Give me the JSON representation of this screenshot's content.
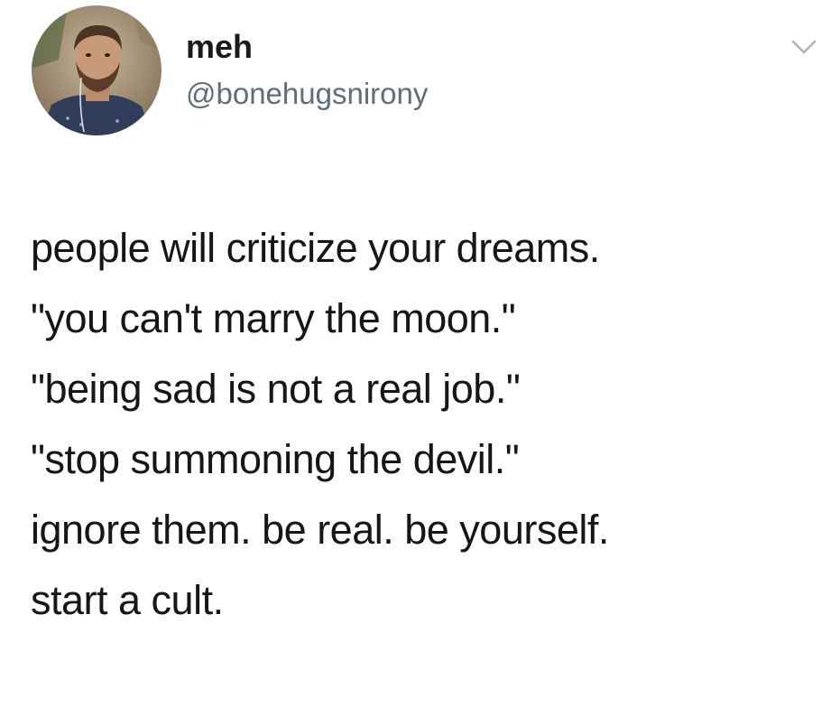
{
  "tweet": {
    "display_name": "meh",
    "handle": "@bonehugsnirony",
    "lines": [
      "people will criticize your dreams.",
      "\"you can't marry the moon.\"",
      "\"being sad is not a real job.\"",
      "\"stop summoning the devil.\"",
      "ignore them. be real. be yourself.",
      "start a cult."
    ]
  },
  "icons": {
    "avatar": "profile-photo",
    "menu": "chevron-down-icon"
  },
  "colors": {
    "background": "#ffffff",
    "name_text": "#1a1a1a",
    "handle_text": "#5e6e7a",
    "body_text": "#161616",
    "chevron": "#aab4bd"
  }
}
